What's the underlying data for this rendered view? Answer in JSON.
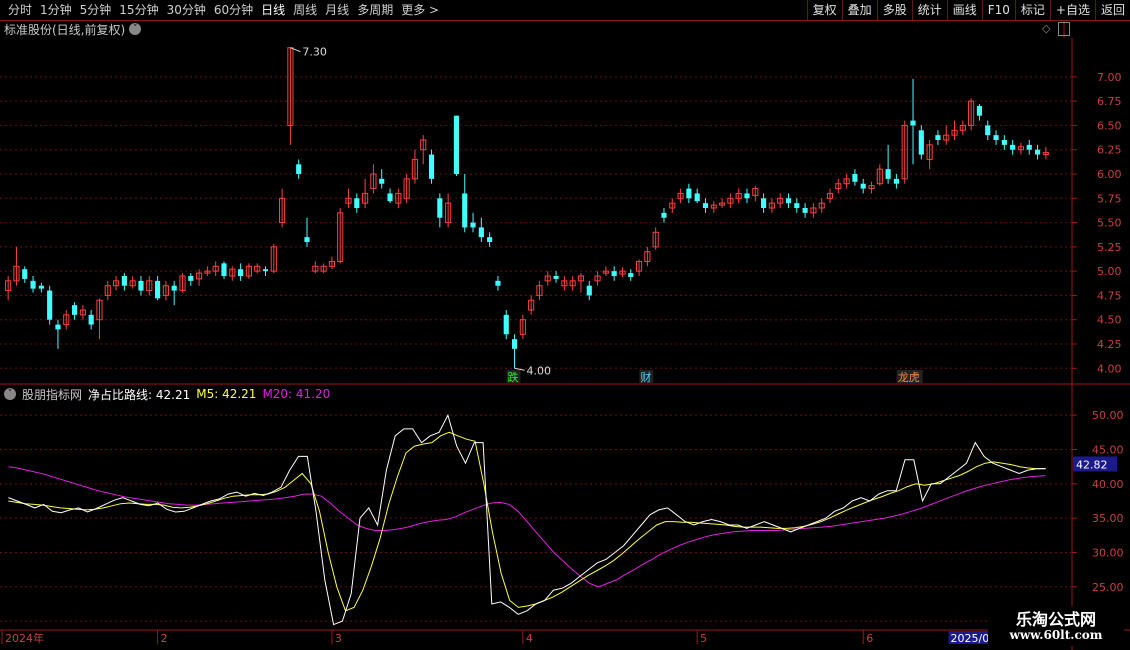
{
  "toolbar": {
    "periods": [
      "分时",
      "1分钟",
      "5分钟",
      "15分钟",
      "30分钟",
      "60分钟",
      "日线",
      "周线",
      "月线",
      "多周期",
      "更多 >"
    ],
    "active_period": "日线",
    "actions": [
      "复权",
      "叠加",
      "多股",
      "统计",
      "画线",
      "F10",
      "标记",
      "+自选",
      "返回"
    ]
  },
  "main": {
    "title": "标准股份(日线,前复权)",
    "high_label": "7.30",
    "low_label": "4.00",
    "y_ticks": [
      "7.00",
      "6.75",
      "6.50",
      "6.25",
      "6.00",
      "5.75",
      "5.50",
      "5.25",
      "5.00",
      "4.75",
      "4.50",
      "4.25",
      "4.00"
    ],
    "markers": [
      {
        "text": "跌",
        "color": "#1aff1a"
      },
      {
        "text": "财",
        "color": "#55ccff"
      },
      {
        "text": "龙虎",
        "color": "#ff8844"
      }
    ]
  },
  "indicator": {
    "name": "股朋指标网",
    "line_label": "净占比路线: 42.21",
    "m5_label": "M5: 42.21",
    "m20_label": "M20: 41.20",
    "y_ticks": [
      "50.00",
      "45.00",
      "40.00",
      "35.00",
      "30.00",
      "25.00",
      "20.00"
    ],
    "current_value": "42.82",
    "colors": {
      "line": "#ffffff",
      "m5": "#ffff40",
      "m20": "#e020e0"
    }
  },
  "xaxis": {
    "labels": [
      "2024年",
      "2",
      "3",
      "4",
      "5",
      "6"
    ],
    "current_date": "2025/06/2"
  },
  "watermark": {
    "title": "乐淘公式网",
    "url": "www.60lt.com"
  },
  "chart_data": {
    "type": "candlestick",
    "ylim": [
      3.9,
      7.4
    ],
    "candles": [
      [
        4.8,
        4.9,
        4.7,
        4.95
      ],
      [
        4.9,
        5.05,
        4.85,
        5.25
      ],
      [
        5.02,
        4.92,
        4.88,
        5.05
      ],
      [
        4.9,
        4.82,
        4.78,
        4.95
      ],
      [
        4.85,
        4.82,
        4.78,
        4.88
      ],
      [
        4.8,
        4.5,
        4.45,
        4.85
      ],
      [
        4.45,
        4.4,
        4.2,
        4.5
      ],
      [
        4.45,
        4.55,
        4.4,
        4.6
      ],
      [
        4.65,
        4.55,
        4.5,
        4.68
      ],
      [
        4.55,
        4.6,
        4.5,
        4.65
      ],
      [
        4.55,
        4.45,
        4.4,
        4.6
      ],
      [
        4.5,
        4.7,
        4.3,
        4.72
      ],
      [
        4.75,
        4.85,
        4.7,
        4.9
      ],
      [
        4.85,
        4.9,
        4.8,
        4.95
      ],
      [
        4.95,
        4.85,
        4.8,
        4.98
      ],
      [
        4.85,
        4.9,
        4.82,
        4.95
      ],
      [
        4.9,
        4.8,
        4.75,
        4.95
      ],
      [
        4.8,
        4.9,
        4.75,
        4.95
      ],
      [
        4.9,
        4.72,
        4.7,
        4.95
      ],
      [
        4.75,
        4.85,
        4.7,
        4.9
      ],
      [
        4.85,
        4.8,
        4.65,
        4.9
      ],
      [
        4.8,
        4.95,
        4.78,
        4.98
      ],
      [
        4.95,
        4.9,
        4.85,
        4.98
      ],
      [
        4.92,
        4.98,
        4.85,
        5.02
      ],
      [
        4.98,
        5.0,
        4.95,
        5.05
      ],
      [
        5.0,
        5.05,
        4.95,
        5.1
      ],
      [
        5.08,
        4.95,
        4.92,
        5.1
      ],
      [
        4.95,
        5.02,
        4.9,
        5.05
      ],
      [
        5.02,
        4.95,
        4.9,
        5.08
      ],
      [
        4.95,
        5.05,
        4.92,
        5.08
      ],
      [
        5.0,
        5.05,
        4.98,
        5.08
      ],
      [
        5.02,
        5.0,
        4.95,
        5.05
      ],
      [
        5.0,
        5.25,
        4.98,
        5.28
      ],
      [
        5.5,
        5.75,
        5.45,
        5.85
      ],
      [
        6.5,
        7.3,
        6.3,
        7.3
      ],
      [
        6.1,
        6.0,
        5.95,
        6.15
      ],
      [
        5.35,
        5.3,
        5.25,
        5.55
      ],
      [
        5.0,
        5.05,
        4.98,
        5.1
      ],
      [
        5.0,
        5.05,
        4.98,
        5.08
      ],
      [
        5.05,
        5.1,
        5.02,
        5.15
      ],
      [
        5.1,
        5.6,
        5.08,
        5.65
      ],
      [
        5.7,
        5.75,
        5.65,
        5.85
      ],
      [
        5.75,
        5.65,
        5.6,
        5.8
      ],
      [
        5.7,
        5.8,
        5.65,
        5.95
      ],
      [
        5.85,
        6.0,
        5.8,
        6.1
      ],
      [
        5.95,
        5.9,
        5.85,
        6.05
      ],
      [
        5.8,
        5.72,
        5.7,
        5.85
      ],
      [
        5.7,
        5.8,
        5.65,
        5.85
      ],
      [
        5.75,
        5.95,
        5.7,
        6.0
      ],
      [
        5.95,
        6.15,
        5.9,
        6.25
      ],
      [
        6.25,
        6.35,
        6.1,
        6.4
      ],
      [
        6.2,
        5.95,
        5.9,
        6.25
      ],
      [
        5.75,
        5.55,
        5.45,
        5.8
      ],
      [
        5.5,
        5.7,
        5.45,
        5.8
      ],
      [
        6.6,
        6.0,
        5.98,
        6.6
      ],
      [
        5.8,
        5.45,
        5.4,
        6.0
      ],
      [
        5.5,
        5.45,
        5.4,
        5.6
      ],
      [
        5.45,
        5.35,
        5.3,
        5.55
      ],
      [
        5.35,
        5.3,
        5.25,
        5.4
      ],
      [
        4.9,
        4.85,
        4.8,
        4.95
      ],
      [
        4.55,
        4.35,
        4.3,
        4.6
      ],
      [
        4.3,
        4.2,
        4.0,
        4.35
      ],
      [
        4.35,
        4.5,
        4.3,
        4.55
      ],
      [
        4.6,
        4.7,
        4.55,
        4.75
      ],
      [
        4.75,
        4.85,
        4.7,
        4.9
      ],
      [
        4.9,
        4.95,
        4.85,
        5.0
      ],
      [
        4.95,
        4.92,
        4.88,
        5.0
      ],
      [
        4.85,
        4.9,
        4.8,
        4.95
      ],
      [
        4.85,
        4.9,
        4.8,
        4.95
      ],
      [
        4.9,
        4.95,
        4.78,
        4.98
      ],
      [
        4.85,
        4.75,
        4.7,
        4.9
      ],
      [
        4.9,
        4.95,
        4.85,
        5.0
      ],
      [
        4.98,
        5.0,
        4.95,
        5.05
      ],
      [
        5.0,
        4.95,
        4.9,
        5.05
      ],
      [
        4.97,
        5.0,
        4.94,
        5.04
      ],
      [
        4.98,
        4.94,
        4.9,
        5.02
      ],
      [
        5.0,
        5.1,
        4.95,
        5.12
      ],
      [
        5.1,
        5.2,
        5.05,
        5.25
      ],
      [
        5.25,
        5.4,
        5.22,
        5.45
      ],
      [
        5.6,
        5.55,
        5.5,
        5.65
      ],
      [
        5.65,
        5.7,
        5.6,
        5.75
      ],
      [
        5.75,
        5.8,
        5.7,
        5.85
      ],
      [
        5.85,
        5.75,
        5.7,
        5.9
      ],
      [
        5.8,
        5.72,
        5.7,
        5.85
      ],
      [
        5.7,
        5.65,
        5.6,
        5.75
      ],
      [
        5.65,
        5.68,
        5.6,
        5.72
      ],
      [
        5.68,
        5.7,
        5.65,
        5.75
      ],
      [
        5.7,
        5.75,
        5.65,
        5.8
      ],
      [
        5.75,
        5.8,
        5.7,
        5.85
      ],
      [
        5.8,
        5.75,
        5.7,
        5.85
      ],
      [
        5.78,
        5.85,
        5.72,
        5.88
      ],
      [
        5.75,
        5.65,
        5.6,
        5.8
      ],
      [
        5.65,
        5.7,
        5.6,
        5.75
      ],
      [
        5.7,
        5.75,
        5.65,
        5.8
      ],
      [
        5.75,
        5.7,
        5.65,
        5.8
      ],
      [
        5.7,
        5.65,
        5.6,
        5.75
      ],
      [
        5.65,
        5.6,
        5.55,
        5.7
      ],
      [
        5.6,
        5.65,
        5.55,
        5.7
      ],
      [
        5.65,
        5.7,
        5.6,
        5.75
      ],
      [
        5.75,
        5.8,
        5.7,
        5.85
      ],
      [
        5.85,
        5.9,
        5.8,
        5.95
      ],
      [
        5.9,
        5.95,
        5.85,
        6.0
      ],
      [
        6.0,
        5.92,
        5.88,
        6.05
      ],
      [
        5.9,
        5.85,
        5.8,
        5.95
      ],
      [
        5.85,
        5.88,
        5.8,
        5.92
      ],
      [
        5.9,
        6.05,
        5.88,
        6.1
      ],
      [
        6.05,
        5.95,
        5.9,
        6.3
      ],
      [
        5.95,
        5.9,
        5.85,
        6.0
      ],
      [
        5.95,
        6.5,
        5.9,
        6.55
      ],
      [
        6.55,
        6.5,
        6.1,
        6.98
      ],
      [
        6.45,
        6.2,
        6.15,
        6.5
      ],
      [
        6.15,
        6.3,
        6.05,
        6.35
      ],
      [
        6.4,
        6.35,
        6.3,
        6.45
      ],
      [
        6.35,
        6.4,
        6.3,
        6.5
      ],
      [
        6.4,
        6.45,
        6.35,
        6.55
      ],
      [
        6.45,
        6.5,
        6.4,
        6.55
      ],
      [
        6.5,
        6.75,
        6.45,
        6.78
      ],
      [
        6.7,
        6.6,
        6.55,
        6.72
      ],
      [
        6.5,
        6.4,
        6.35,
        6.55
      ],
      [
        6.4,
        6.35,
        6.3,
        6.45
      ],
      [
        6.35,
        6.3,
        6.25,
        6.4
      ],
      [
        6.3,
        6.25,
        6.2,
        6.35
      ],
      [
        6.25,
        6.28,
        6.2,
        6.32
      ],
      [
        6.3,
        6.25,
        6.2,
        6.35
      ],
      [
        6.25,
        6.2,
        6.15,
        6.3
      ],
      [
        6.2,
        6.22,
        6.15,
        6.28
      ]
    ],
    "indicator_series": {
      "ylim": [
        19.0,
        52.5
      ],
      "line": [
        38,
        37.5,
        37,
        36.5,
        37,
        36,
        35.8,
        36.2,
        36.5,
        35.9,
        36.4,
        37,
        37.6,
        38,
        37.5,
        37,
        36.8,
        37.2,
        36.3,
        35.9,
        36,
        36.5,
        37,
        37.5,
        37.8,
        38.5,
        38.8,
        38.2,
        38.6,
        38.3,
        38.8,
        39.5,
        42,
        44,
        44,
        36,
        26,
        19.5,
        20,
        24,
        35,
        36.5,
        34,
        42,
        47,
        48,
        48,
        46,
        47,
        47.5,
        50,
        45.5,
        43,
        46,
        46,
        22.5,
        22.8,
        22,
        21,
        21.5,
        22.5,
        23,
        24.5,
        24.8,
        25.5,
        26.5,
        27.5,
        28.5,
        29,
        30,
        31,
        32.5,
        34,
        35.5,
        36.2,
        36.5,
        35.5,
        34.5,
        34,
        34.5,
        34.8,
        34.5,
        34,
        34,
        33.5,
        34,
        34.5,
        34,
        33.5,
        33,
        33.5,
        34,
        34.5,
        35,
        36,
        36.5,
        37.5,
        38,
        37.5,
        38.5,
        39,
        39,
        43.5,
        43.5,
        37.5,
        40,
        40,
        41,
        42,
        43,
        46,
        44,
        43,
        42.5,
        42,
        41.5,
        42,
        42.2,
        42.21
      ],
      "m5": [
        37.5,
        37.3,
        37.1,
        37,
        36.9,
        36.7,
        36.5,
        36.4,
        36.3,
        36.2,
        36.3,
        36.5,
        36.8,
        37.1,
        37.2,
        37.1,
        37,
        37,
        36.9,
        36.6,
        36.5,
        36.6,
        36.8,
        37.1,
        37.5,
        37.9,
        38.2,
        38.3,
        38.4,
        38.4,
        38.5,
        38.9,
        39.5,
        40.5,
        41.5,
        40,
        36,
        30,
        25,
        21.5,
        22,
        24.5,
        28,
        32,
        37,
        41,
        44.5,
        45.5,
        45.8,
        46,
        47,
        47.5,
        47,
        46.5,
        46.2,
        40,
        33,
        27,
        23,
        22,
        22.2,
        22.5,
        23,
        23.5,
        24.2,
        25,
        25.8,
        26.6,
        27.3,
        28,
        28.8,
        29.8,
        30.9,
        32,
        33,
        34,
        34.5,
        34.5,
        34.4,
        34.4,
        34.3,
        34.2,
        34.1,
        34,
        33.8,
        33.7,
        33.7,
        33.7,
        33.6,
        33.5,
        33.5,
        33.6,
        33.8,
        34.1,
        34.5,
        35,
        35.6,
        36.2,
        36.7,
        37.2,
        37.7,
        38.1,
        38.6,
        39,
        39.6,
        40,
        39.8,
        40,
        40.4,
        40.8,
        41.2,
        41.8,
        42.5,
        43,
        43.2,
        43,
        42.8,
        42.5,
        42.3,
        42.2,
        42.21
      ],
      "m20": [
        42.5,
        42.3,
        42,
        41.7,
        41.4,
        41,
        40.6,
        40.2,
        39.8,
        39.4,
        39,
        38.7,
        38.4,
        38.1,
        37.9,
        37.7,
        37.5,
        37.3,
        37.1,
        37,
        36.9,
        36.9,
        37,
        37.1,
        37.2,
        37.3,
        37.4,
        37.5,
        37.6,
        37.7,
        37.8,
        38,
        38.2,
        38.5,
        38.5,
        38.2,
        37.2,
        36,
        35,
        34,
        33.5,
        33.2,
        33.2,
        33.3,
        33.5,
        33.8,
        34.2,
        34.5,
        34.7,
        34.8,
        35.2,
        35.8,
        36.3,
        36.8,
        37.2,
        37.3,
        37,
        36,
        34.5,
        33,
        31.5,
        30,
        28.8,
        27.6,
        26.5,
        25.5,
        25,
        25.5,
        26,
        26.8,
        27.5,
        28.3,
        29,
        29.8,
        30.4,
        31,
        31.5,
        31.9,
        32.3,
        32.6,
        32.8,
        33,
        33.1,
        33.2,
        33.2,
        33.2,
        33.2,
        33.3,
        33.4,
        33.5,
        33.6,
        33.7,
        33.8,
        34,
        34.2,
        34.4,
        34.6,
        34.8,
        35,
        35.3,
        35.6,
        36,
        36.4,
        36.9,
        37.4,
        37.9,
        38.4,
        38.9,
        39.3,
        39.7,
        40,
        40.3,
        40.6,
        40.8,
        41,
        41.1,
        41.2
      ]
    }
  }
}
